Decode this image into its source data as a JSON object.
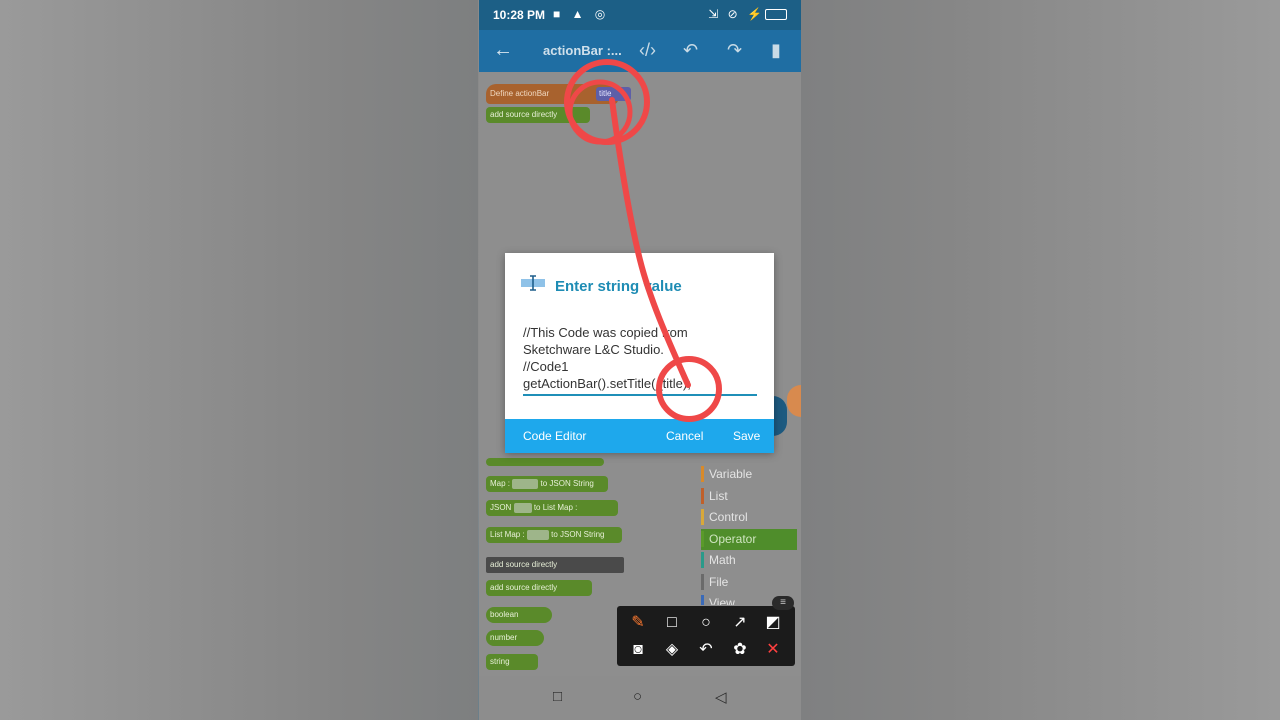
{
  "status_bar": {
    "time": "10:28 PM"
  },
  "app_bar": {
    "title": "actionBar :..."
  },
  "blocks": {
    "define_label": "Define actionBar",
    "define_param": "title",
    "add_source": "add source directly",
    "map_to_json": [
      "Map :",
      "to JSON String"
    ],
    "json_to": [
      "JSON",
      "to",
      "List Map :"
    ],
    "listmap_to_json": [
      "List Map :",
      "to JSON String"
    ],
    "add_source_header": "add source directly",
    "add_source2": "add source directly",
    "boolean": "boolean",
    "number": "number",
    "string": "string"
  },
  "palette": {
    "items": [
      {
        "label": "Variable",
        "color": "#d88a2a"
      },
      {
        "label": "List",
        "color": "#c0602a"
      },
      {
        "label": "Control",
        "color": "#d8a83a"
      },
      {
        "label": "Operator",
        "color": "#5a9a2a"
      },
      {
        "label": "Math",
        "color": "#2a9a8a"
      },
      {
        "label": "File",
        "color": "#6a6a6a"
      },
      {
        "label": "View",
        "color": "#3a6ab8"
      }
    ]
  },
  "dialog": {
    "title": "Enter string value",
    "code": "//This Code was copied from\nSketchware L&C Studio.\n//Code1\ngetActionBar().setTitle(_title);",
    "code_editor_label": "Code Editor",
    "cancel_label": "Cancel",
    "save_label": "Save"
  },
  "annotation_toolbox": {
    "tools": [
      "brush-icon",
      "square-icon",
      "circle-icon",
      "arrow-icon",
      "checker-icon",
      "camera-icon",
      "eraser-icon",
      "undo-icon",
      "palette-icon",
      "close-icon"
    ]
  },
  "colors": {
    "status_bar": "#1c5f86",
    "app_bar": "#1f6ea3",
    "dialog_accent": "#1e8cb4",
    "dialog_footer": "#1ea8ec",
    "annotation_red": "#ef4848"
  }
}
